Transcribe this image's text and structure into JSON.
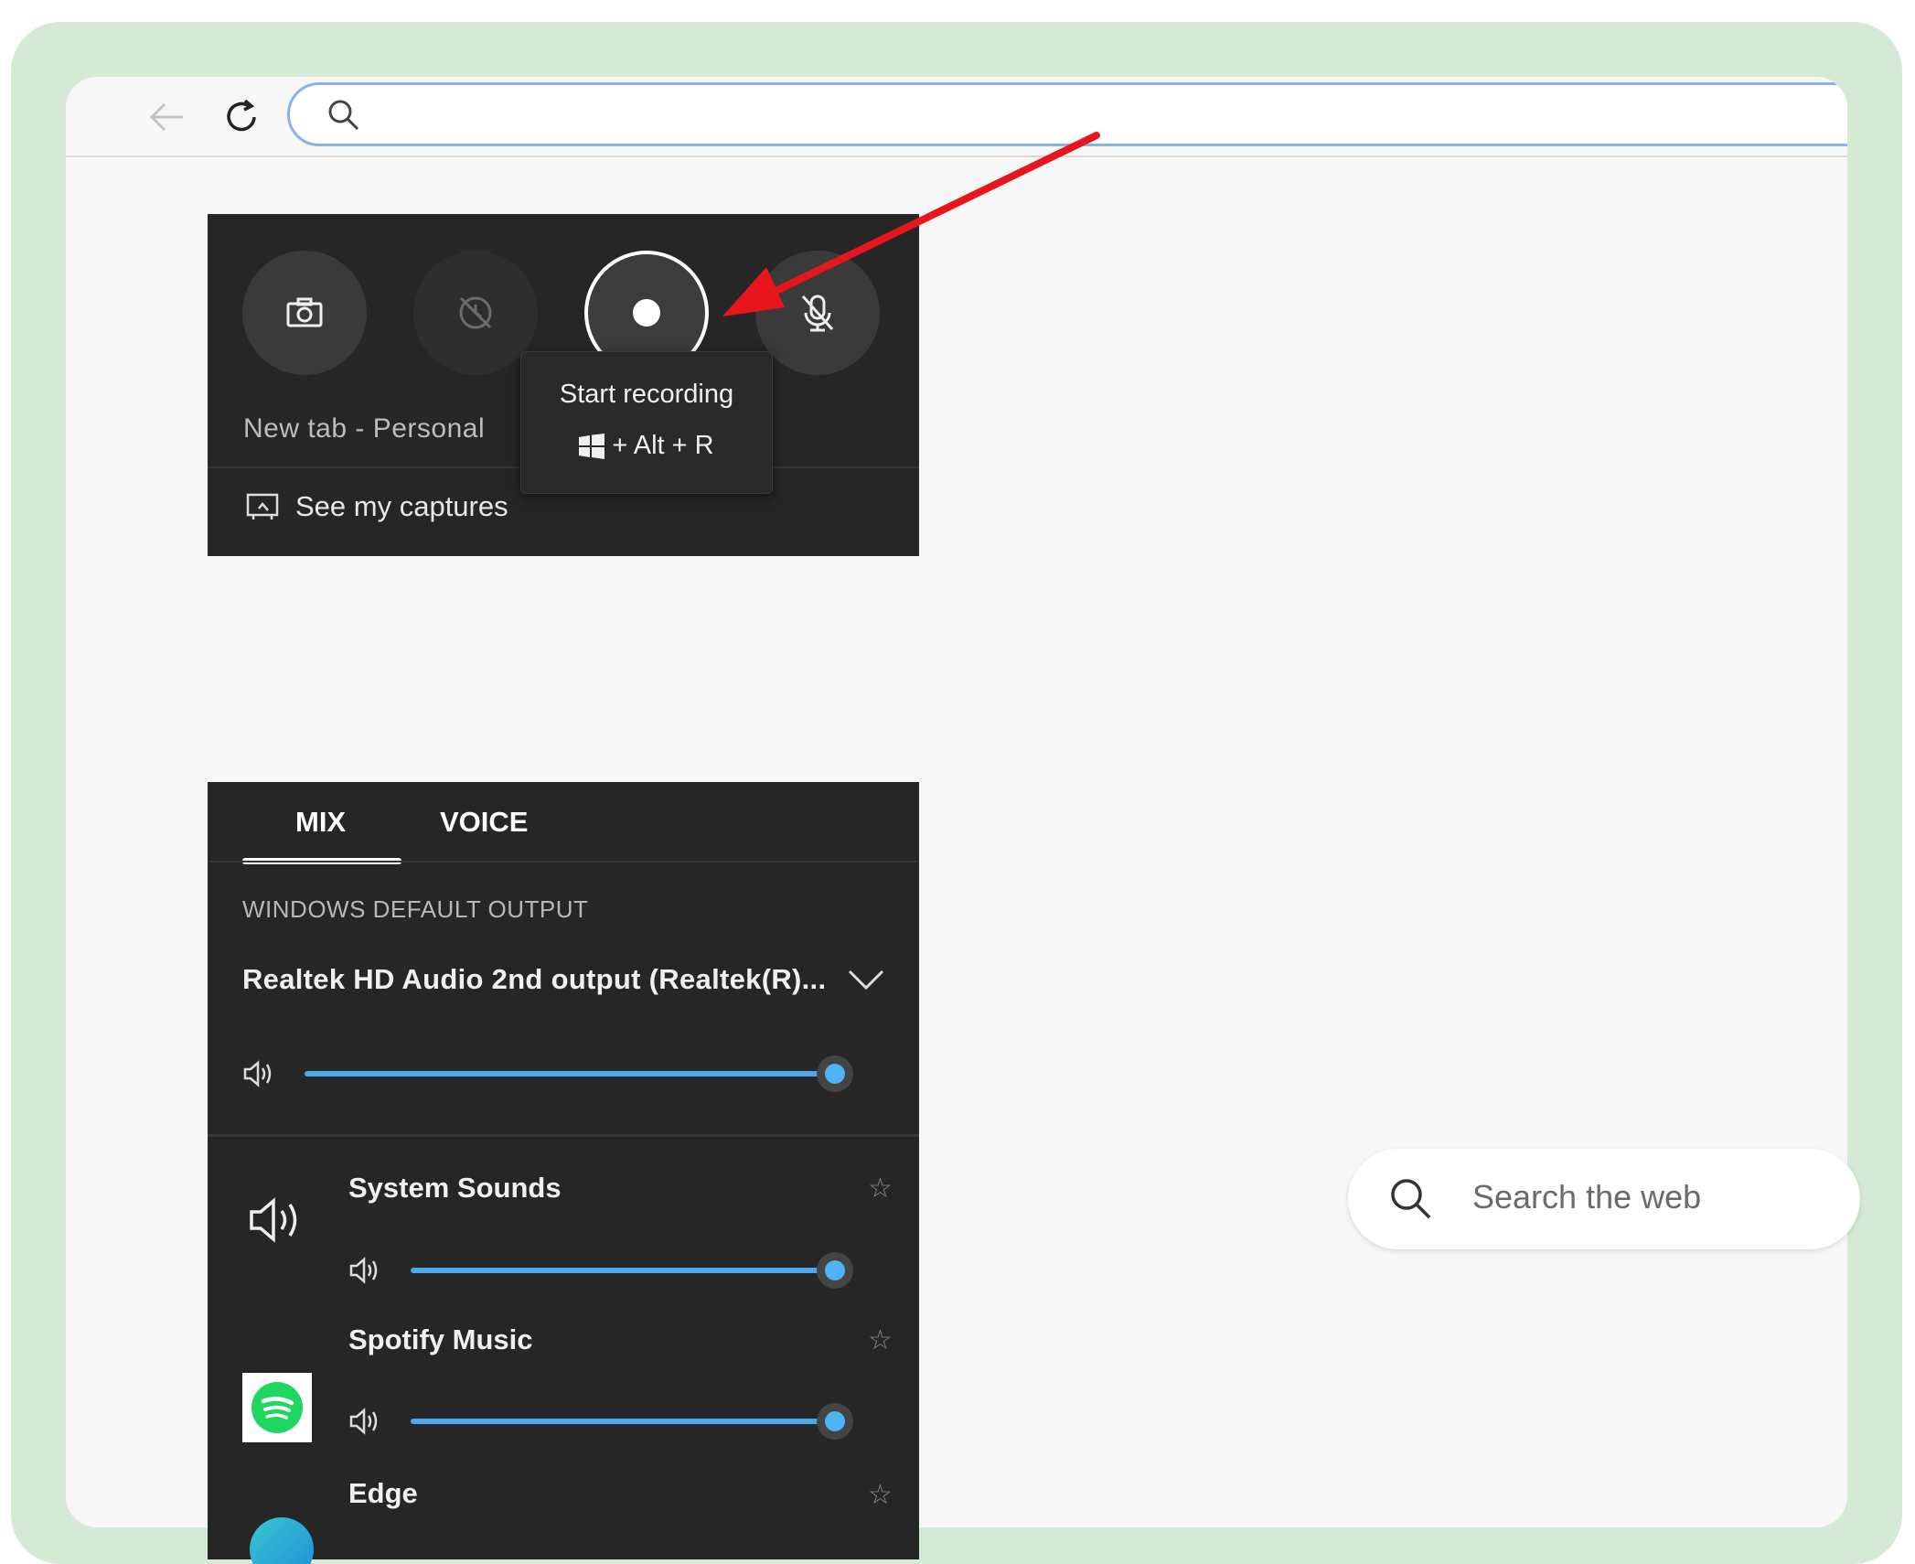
{
  "browser": {
    "back_icon": "arrow-left-icon",
    "refresh_icon": "refresh-icon",
    "address_bar": {
      "placeholder": "",
      "value": ""
    }
  },
  "capture_widget": {
    "buttons": [
      {
        "name": "screenshot-button",
        "icon": "camera-icon"
      },
      {
        "name": "record-last-30-button",
        "icon": "record-last-disabled-icon"
      },
      {
        "name": "start-recording-button",
        "icon": "record-icon"
      },
      {
        "name": "mic-toggle-button",
        "icon": "mic-off-icon"
      }
    ],
    "target_title": "New tab - Personal",
    "see_captures_label": "See my captures",
    "tooltip": {
      "title": "Start recording",
      "shortcut_suffix": "+ Alt + R"
    }
  },
  "audio_widget": {
    "tabs": [
      {
        "label": "MIX",
        "active": true
      },
      {
        "label": "VOICE",
        "active": false
      }
    ],
    "section_label": "WINDOWS DEFAULT OUTPUT",
    "output_device": "Realtek HD Audio 2nd output (Realtek(R)...",
    "master_volume": 1.0,
    "apps": [
      {
        "name": "System Sounds",
        "volume": 1.0,
        "icon": "speaker-icon"
      },
      {
        "name": "Spotify Music",
        "volume": 1.0,
        "icon": "spotify-icon"
      },
      {
        "name": "Edge",
        "volume": 1.0,
        "icon": "edge-icon"
      }
    ]
  },
  "new_tab_page": {
    "search_placeholder": "Search the web"
  },
  "colors": {
    "accent_blue": "#4fb3f5",
    "panel_bg": "#262626",
    "annotation_arrow": "#e8161c",
    "spotify_green": "#1ed760"
  }
}
